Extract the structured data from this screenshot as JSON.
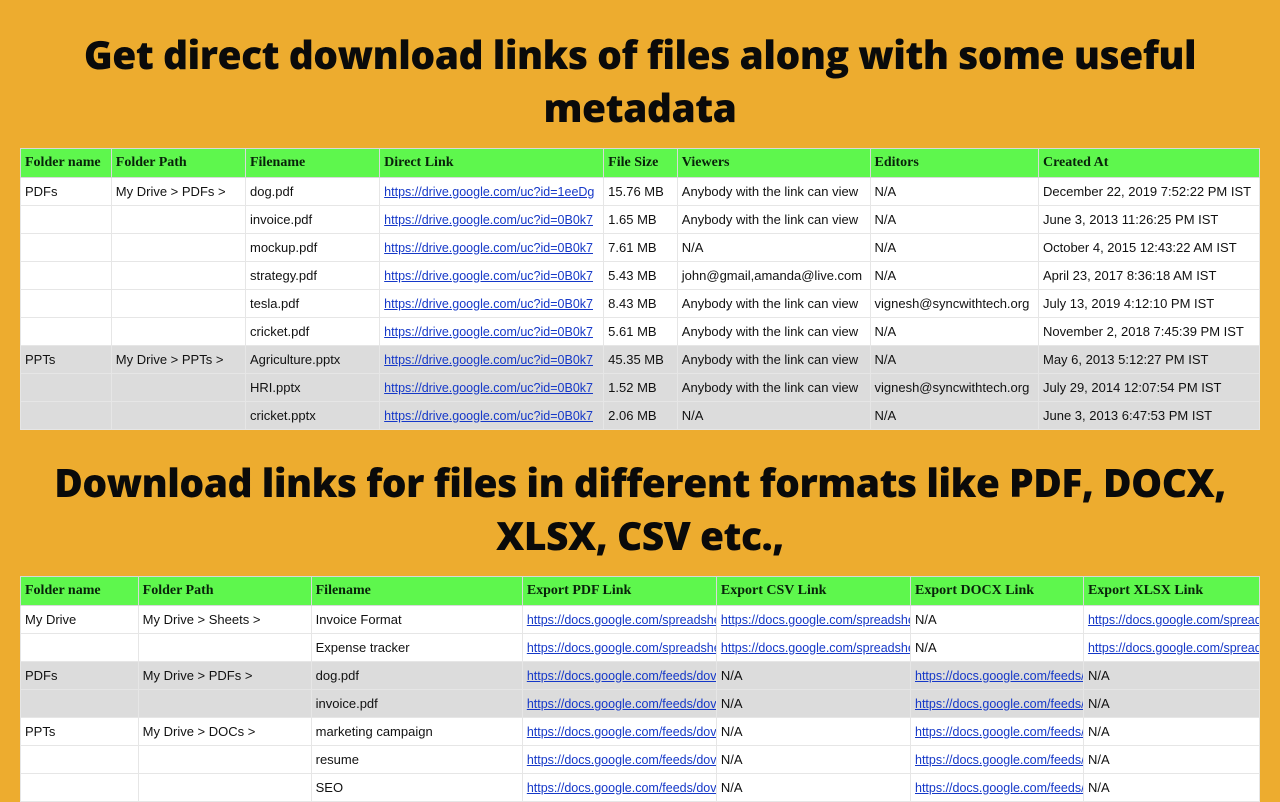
{
  "heading1": "Get direct download links of files along with some useful metadata",
  "heading2": "Download links for files in different formats like PDF, DOCX, XLSX, CSV etc.,",
  "table1": {
    "headers": [
      "Folder name",
      "Folder Path",
      "Filename",
      "Direct Link",
      "File Size",
      "Viewers",
      "Editors",
      "Created At"
    ],
    "rows": [
      {
        "folder": "PDFs",
        "path": "My Drive > PDFs >",
        "file": "dog.pdf",
        "link": "https://drive.google.com/uc?id=1eeDg",
        "size": "15.76 MB",
        "viewers": "Anybody with the link can view",
        "editors": "N/A",
        "created": "December 22, 2019 7:52:22 PM IST",
        "gray": false
      },
      {
        "folder": "",
        "path": "",
        "file": "invoice.pdf",
        "link": "https://drive.google.com/uc?id=0B0k7",
        "size": "1.65 MB",
        "viewers": "Anybody with the link can view",
        "editors": "N/A",
        "created": "June 3, 2013 11:26:25 PM IST",
        "gray": false
      },
      {
        "folder": "",
        "path": "",
        "file": "mockup.pdf",
        "link": "https://drive.google.com/uc?id=0B0k7",
        "size": "7.61 MB",
        "viewers": "N/A",
        "editors": "N/A",
        "created": "October 4, 2015 12:43:22 AM IST",
        "gray": false
      },
      {
        "folder": "",
        "path": "",
        "file": "strategy.pdf",
        "link": "https://drive.google.com/uc?id=0B0k7",
        "size": "5.43 MB",
        "viewers": "john@gmail,amanda@live.com",
        "editors": "N/A",
        "created": "April 23, 2017 8:36:18 AM IST",
        "gray": false
      },
      {
        "folder": "",
        "path": "",
        "file": "tesla.pdf",
        "link": "https://drive.google.com/uc?id=0B0k7",
        "size": "8.43 MB",
        "viewers": "Anybody with the link can view",
        "editors": "vignesh@syncwithtech.org",
        "created": "July 13, 2019 4:12:10 PM IST",
        "gray": false
      },
      {
        "folder": "",
        "path": "",
        "file": "cricket.pdf",
        "link": "https://drive.google.com/uc?id=0B0k7",
        "size": "5.61 MB",
        "viewers": "Anybody with the link can view",
        "editors": "N/A",
        "created": "November 2, 2018 7:45:39 PM IST",
        "gray": false
      },
      {
        "folder": "PPTs",
        "path": "My Drive > PPTs >",
        "file": "Agriculture.pptx",
        "link": "https://drive.google.com/uc?id=0B0k7",
        "size": "45.35 MB",
        "viewers": "Anybody with the link can view",
        "editors": "N/A",
        "created": "May 6, 2013 5:12:27 PM IST",
        "gray": true
      },
      {
        "folder": "",
        "path": "",
        "file": "HRI.pptx",
        "link": "https://drive.google.com/uc?id=0B0k7",
        "size": "1.52 MB",
        "viewers": "Anybody with the link can view",
        "editors": "vignesh@syncwithtech.org",
        "created": "July 29, 2014 12:07:54 PM IST",
        "gray": true
      },
      {
        "folder": "",
        "path": "",
        "file": "cricket.pptx",
        "link": "https://drive.google.com/uc?id=0B0k7",
        "size": "2.06 MB",
        "viewers": "N/A",
        "editors": "N/A",
        "created": "June 3, 2013 6:47:53 PM IST",
        "gray": true
      }
    ]
  },
  "table2": {
    "headers": [
      "Folder name",
      "Folder Path",
      "Filename",
      "Export PDF Link",
      "Export CSV Link",
      "Export DOCX Link",
      "Export XLSX Link"
    ],
    "rows": [
      {
        "folder": "My Drive",
        "path": "My Drive > Sheets >",
        "file": "Invoice Format",
        "pdf": "https://docs.google.com/spreadshe",
        "csv": "https://docs.google.com/spreadshe",
        "docx": "N/A",
        "xlsx": "https://docs.google.com/spreadsh",
        "gray": false
      },
      {
        "folder": "",
        "path": "",
        "file": "Expense tracker",
        "pdf": "https://docs.google.com/spreadshe",
        "csv": "https://docs.google.com/spreadshe",
        "docx": "N/A",
        "xlsx": "https://docs.google.com/spreadsh",
        "gray": false
      },
      {
        "folder": "PDFs",
        "path": "My Drive > PDFs >",
        "file": "dog.pdf",
        "pdf": "https://docs.google.com/feeds/dov",
        "csv": "N/A",
        "docx": "https://docs.google.com/feeds/",
        "xlsx": "N/A",
        "gray": true
      },
      {
        "folder": "",
        "path": "",
        "file": "invoice.pdf",
        "pdf": "https://docs.google.com/feeds/dov",
        "csv": "N/A",
        "docx": "https://docs.google.com/feeds/",
        "xlsx": "N/A",
        "gray": true
      },
      {
        "folder": "PPTs",
        "path": "My Drive > DOCs >",
        "file": "marketing campaign",
        "pdf": "https://docs.google.com/feeds/dov",
        "csv": "N/A",
        "docx": "https://docs.google.com/feeds/",
        "xlsx": "N/A",
        "gray": false
      },
      {
        "folder": "",
        "path": "",
        "file": "resume",
        "pdf": "https://docs.google.com/feeds/dov",
        "csv": "N/A",
        "docx": "https://docs.google.com/feeds/",
        "xlsx": "N/A",
        "gray": false
      },
      {
        "folder": "",
        "path": "",
        "file": "SEO",
        "pdf": "https://docs.google.com/feeds/dov",
        "csv": "N/A",
        "docx": "https://docs.google.com/feeds/",
        "xlsx": "N/A",
        "gray": false
      }
    ]
  }
}
